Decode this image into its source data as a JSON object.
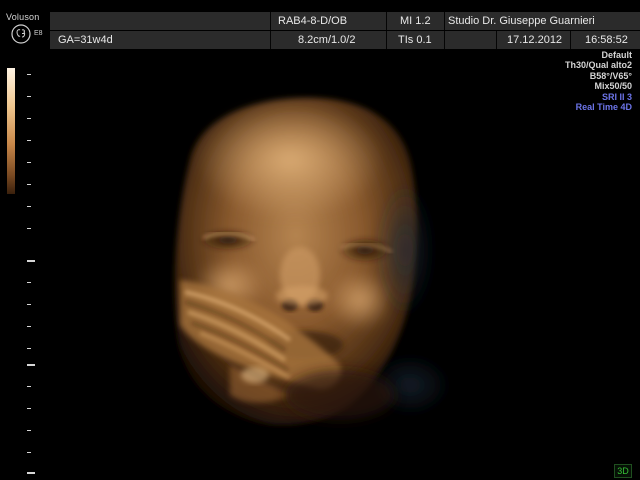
{
  "device": {
    "brand": "Voluson",
    "model": "E8",
    "logo_icon": "ge-logo-icon"
  },
  "header": {
    "row1": {
      "probe": "RAB4-8-D/OB",
      "mi": "MI  1.2",
      "institution": "Studio Dr. Giuseppe Guarnieri"
    },
    "row2": {
      "ga": "GA=31w4d",
      "depth": "8.2cm/1.0/2",
      "tis": "TIs  0.1",
      "date": "17.12.2012",
      "time": "16:58:52"
    }
  },
  "parameters": {
    "lines": [
      "Default",
      "Th30/Qual alto2",
      "B58°/V65°",
      "Mix50/50"
    ],
    "blue_lines": [
      "SRI II 3",
      "Real Time 4D"
    ],
    "blue_color": "#6c74e8"
  },
  "image": {
    "description_icon": "fetal-face-render",
    "tint_color": "#c8884a"
  },
  "mode_indicator": "3D"
}
